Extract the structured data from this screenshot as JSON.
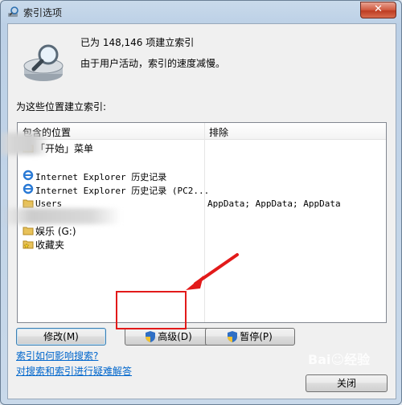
{
  "window": {
    "title": "索引选项",
    "close_label": "✕"
  },
  "status": {
    "count_text": "已为 148,146 项建立索引",
    "activity_text": "由于用户活动，索引的速度减慢。"
  },
  "locations": {
    "section_label": "为这些位置建立索引:",
    "col_included": "包含的位置",
    "col_excluded": "排除",
    "rows": [
      {
        "icon": "folder-icon",
        "location": "「开始」菜单",
        "exclude": ""
      },
      {
        "icon": "ie-icon",
        "location": "Internet Explorer 历史记录",
        "exclude": ""
      },
      {
        "icon": "ie-icon",
        "location": "Internet Explorer 历史记录 (PC2...",
        "exclude": ""
      },
      {
        "icon": "folder-icon",
        "location": "Users",
        "exclude": "AppData; AppData; AppData"
      },
      {
        "icon": "folder-icon",
        "location": "娱乐 (G:)",
        "exclude": ""
      },
      {
        "icon": "star-folder-icon",
        "location": "收藏夹",
        "exclude": ""
      }
    ]
  },
  "buttons": {
    "modify": "修改(M)",
    "advanced": "高级(D)",
    "pause": "暂停(P)",
    "close": "关闭"
  },
  "links": {
    "how_affects": "索引如何影响搜索?",
    "troubleshoot": "对搜索和索引进行疑难解答"
  },
  "colors": {
    "link": "#0066cc",
    "highlight": "#e21a1a"
  }
}
